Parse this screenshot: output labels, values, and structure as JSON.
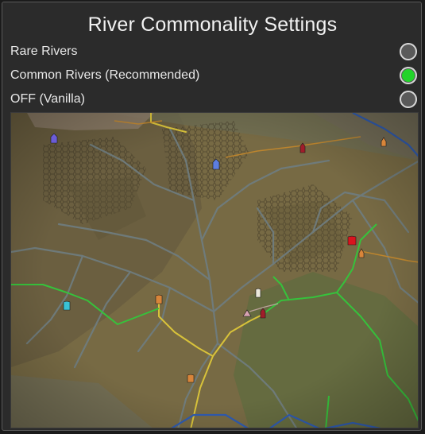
{
  "title": "River Commonality Settings",
  "options": [
    {
      "label": "Rare Rivers",
      "selected": false
    },
    {
      "label": "Common Rivers (Recommended)",
      "selected": true
    },
    {
      "label": "OFF (Vanilla)",
      "selected": false
    }
  ],
  "colors": {
    "selected_radio": "#22d42a",
    "unselected_radio": "#5a5a5a",
    "river": "#6f7c7e",
    "road": "#d8c23a",
    "green_border": "#36c23c",
    "blue_border": "#2f5bb0",
    "orange_border": "#c98a2a",
    "pink_border": "#e0b8c0"
  },
  "map_icons": [
    {
      "name": "settlement-purple-icon",
      "color": "#6b5cd6"
    },
    {
      "name": "settlement-red-icon",
      "color": "#a01d2a"
    },
    {
      "name": "settlement-blue-icon",
      "color": "#5d7ee0"
    },
    {
      "name": "settlement-orange-icon",
      "color": "#d8853a"
    },
    {
      "name": "settlement-cyan-icon",
      "color": "#39c2d6"
    },
    {
      "name": "settlement-white-icon",
      "color": "#ece8dc"
    },
    {
      "name": "settlement-bright-red-icon",
      "color": "#d8141e"
    },
    {
      "name": "camp-pink-icon",
      "color": "#d8a2b2"
    }
  ]
}
